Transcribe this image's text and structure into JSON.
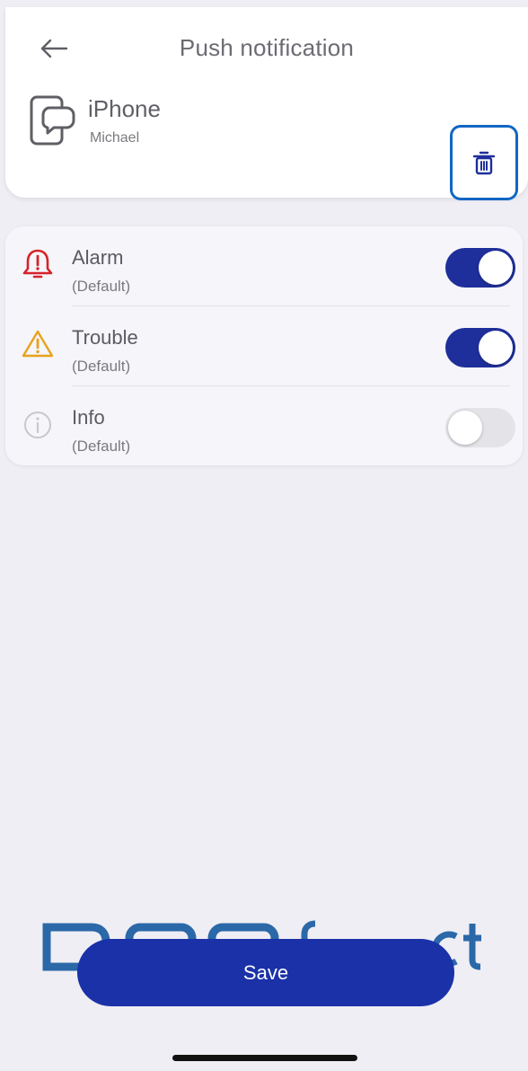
{
  "header": {
    "title": "Push notification",
    "back_icon": "arrow-left-icon"
  },
  "device": {
    "name": "iPhone",
    "owner": "Michael",
    "icon": "device-chat-icon",
    "delete_icon": "trash-icon"
  },
  "notifications": [
    {
      "label": "Alarm",
      "sub": "(Default)",
      "icon": "alarm-bell-icon",
      "enabled": true,
      "color": "#d6222a"
    },
    {
      "label": "Trouble",
      "sub": "(Default)",
      "icon": "warning-triangle-icon",
      "enabled": true,
      "color": "#e8a21c"
    },
    {
      "label": "Info",
      "sub": "(Default)",
      "icon": "info-circle-icon",
      "enabled": false,
      "color": "#c8c8cc"
    }
  ],
  "footer": {
    "save_label": "Save"
  },
  "colors": {
    "primary": "#1a31a8",
    "toggle_on": "#1e2f9b",
    "highlight": "#1166c4",
    "background": "#efeef4"
  }
}
